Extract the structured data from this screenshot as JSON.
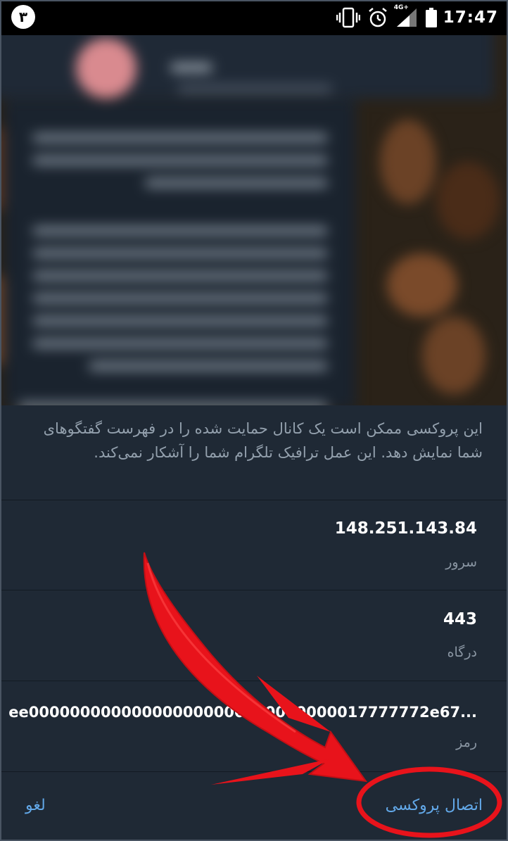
{
  "status_bar": {
    "step_number": "۳",
    "network_label": "4G+",
    "time": "17:47"
  },
  "proxy_sheet": {
    "notice": "این پروکسی ممکن است یک کانال حمایت شده را در فهرست گفتگوهای شما نمایش دهد. این عمل ترافیک تلگرام شما را آشکار نمی‌کند.",
    "fields": [
      {
        "value": "148.251.143.84",
        "label": "سرور"
      },
      {
        "value": "443",
        "label": "درگاه"
      },
      {
        "value": "ee000000000000000000000000000000017777772e67...",
        "label": "رمز"
      }
    ],
    "cancel_label": "لغو",
    "connect_label": "اتصال پروکسی"
  },
  "colors": {
    "sheet_bg": "#1f2935",
    "accent": "#62a8e8",
    "annotation": "#e8131b"
  }
}
